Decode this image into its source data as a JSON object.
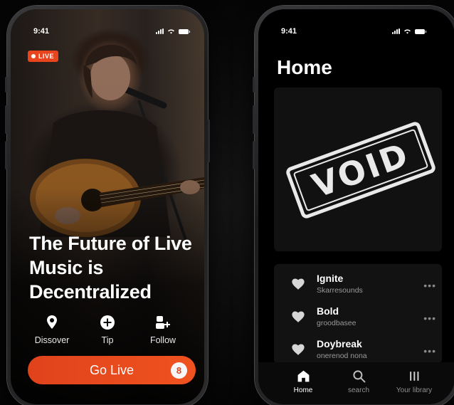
{
  "left_phone": {
    "status": {
      "time": "9:41"
    },
    "live_badge": "LIVE",
    "headline": "The Future of Live Music is Decentralized",
    "actions": [
      {
        "label": "Dissover",
        "icon": "location-pin-icon"
      },
      {
        "label": "Tip",
        "icon": "plus-circle-icon"
      },
      {
        "label": "Follow",
        "icon": "user-add-icon"
      }
    ],
    "go_live": {
      "label": "Go Live",
      "logo": "8"
    }
  },
  "right_phone": {
    "status": {
      "time": "9:41"
    },
    "title": "Home",
    "stamp": "VOID",
    "tracks": [
      {
        "title": "Ignite",
        "artist": "Skarresounds"
      },
      {
        "title": "Bold",
        "artist": "groodbasee"
      },
      {
        "title": "Doybreak",
        "artist": "onerenod nona"
      }
    ],
    "more": "•••",
    "tabs": [
      {
        "label": "Home",
        "icon": "home-icon",
        "active": true
      },
      {
        "label": "search",
        "icon": "search-icon",
        "active": false
      },
      {
        "label": "Your library",
        "icon": "library-icon",
        "active": false
      }
    ]
  },
  "colors": {
    "accent": "#e8451f",
    "background": "#0a0a0a"
  }
}
